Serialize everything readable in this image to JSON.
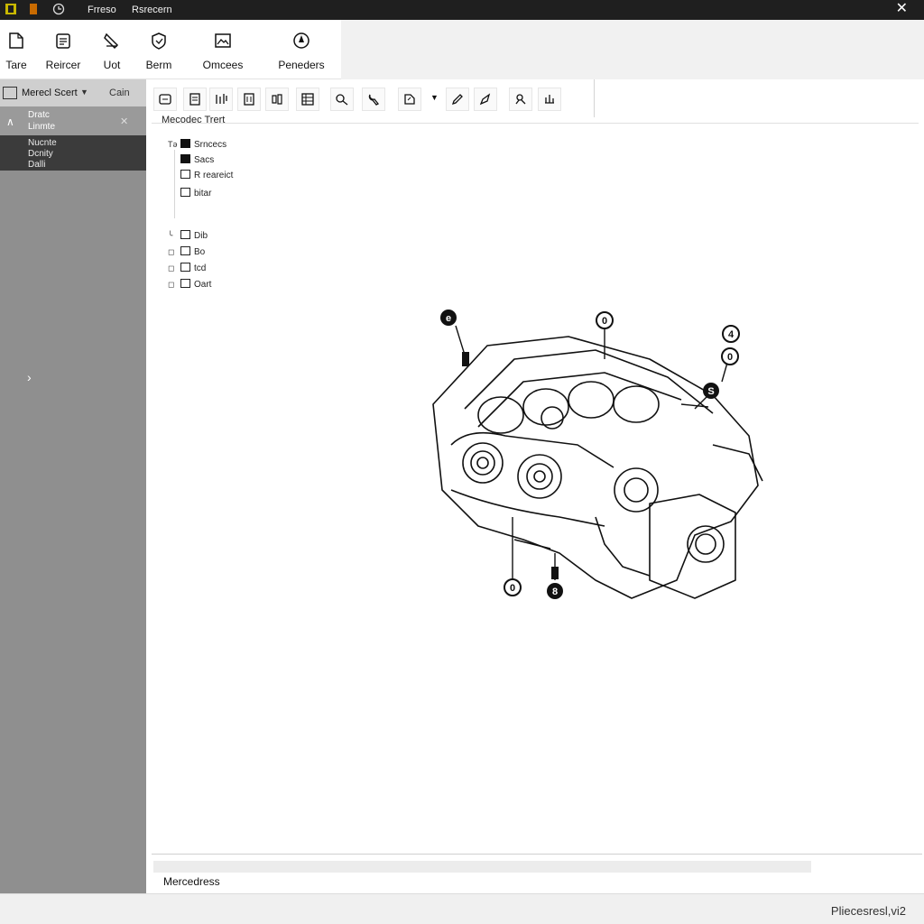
{
  "titlebar": {
    "menu_1": "Frreso",
    "menu_2": "Rsrecern",
    "close_glyph": "✕"
  },
  "ribbon": {
    "buttons": [
      {
        "label": "Tare",
        "icon": "document-icon"
      },
      {
        "label": "Reircer",
        "icon": "print-icon"
      },
      {
        "label": "Uot",
        "icon": "edit-icon"
      },
      {
        "label": "Berm",
        "icon": "shield-icon"
      },
      {
        "label": "Omcees",
        "icon": "image-icon"
      },
      {
        "label": "Peneders",
        "icon": "compass-icon"
      }
    ]
  },
  "sidebar": {
    "title": "Merecl Scert",
    "action": "Cain",
    "row_a": "Dratc",
    "row_b": "Linmte",
    "items": [
      "Nucnte",
      "Dcnity",
      "Dalli"
    ],
    "expander": "›"
  },
  "main": {
    "toolbar_icons": [
      "grid-icon",
      "list-icon",
      "columns-icon",
      "select-icon",
      "layers-icon",
      "table-icon",
      "tool-icon",
      "wrench-icon",
      "stamp-icon",
      "dropdown-caret-icon",
      "pen-icon",
      "pencil-icon",
      "measure-icon",
      "connector-icon"
    ],
    "tree_title": "Mecodec Trert",
    "tree": [
      {
        "prefix": "Tə",
        "label": "Srncecs",
        "box": "fill"
      },
      {
        "prefix": "",
        "label": "Sacs",
        "box": "fill"
      },
      {
        "prefix": "",
        "label": "R reareict",
        "box": "out"
      },
      {
        "prefix": "",
        "label": "bitar",
        "box": "out"
      },
      {
        "prefix": "╰",
        "label": "Dib",
        "box": "out"
      },
      {
        "prefix": "◻",
        "label": "Bo",
        "box": "out"
      },
      {
        "prefix": "◻",
        "label": "tcd",
        "box": "out"
      },
      {
        "prefix": "◻",
        "label": "Oart",
        "box": "out"
      }
    ],
    "callouts": [
      "e",
      "0",
      "4",
      "0",
      "S",
      "0",
      "8"
    ],
    "status_label": "Mercedress"
  },
  "footer": {
    "version": "Pliecesresl,vi2"
  },
  "colors": {
    "titlebar": "#1f1f1f",
    "sidebar": "#8f8f8f",
    "sidebar_list": "#3b3b3b"
  }
}
